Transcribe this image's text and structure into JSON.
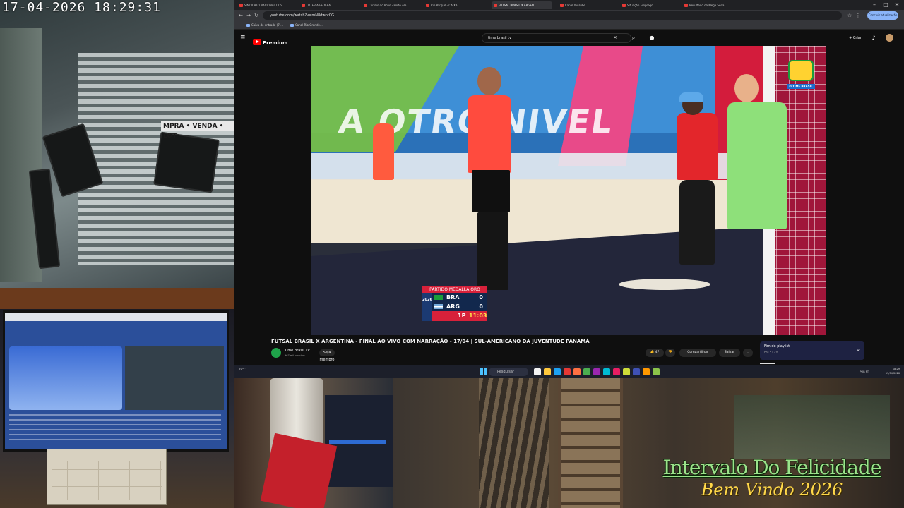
{
  "camera": {
    "timestamp": "17-04-2026  18:29:31",
    "sign_text": "MPRA • VENDA • LOT"
  },
  "overlay": {
    "line1": "Intervalo Do Felicidade",
    "line2": "Bem Vindo 2026"
  },
  "browser": {
    "tabs": [
      {
        "label": "SINDICATO NACIONAL DOS..."
      },
      {
        "label": "LOTERIA FEDERAL"
      },
      {
        "label": "Correio do Povo - Porto Ale..."
      },
      {
        "label": "Rio Parquê - CAIXA..."
      },
      {
        "label": "FUTSAL BRASIL X ARGENT..."
      },
      {
        "label": "Canal YouTube"
      },
      {
        "label": "Situação Emprego..."
      },
      {
        "label": "Resultado da Mega Sena..."
      }
    ],
    "url": "youtube.com/watch?v=mN8dwcc0G",
    "gemini_label": "Concluir atualização",
    "bookmarks": [
      "Caixa de entrada (7)...",
      "Canal Rio Grande..."
    ]
  },
  "youtube": {
    "logo": "Premium",
    "search_value": "time brasil tv",
    "create_label": "+ Criar",
    "video_title": "FUTSAL BRASIL X ARGENTINA - FINAL AO VIVO COM NARRAÇÃO - 17/04 | SUL-AMERICANO DA JUVENTUDE PANAMÁ",
    "channel_name": "Time Brasil TV",
    "channel_subs": "967 mil inscritos",
    "member_label": "Seja membro",
    "likes": "47",
    "share_label": "Compartilhar",
    "save_label": "Salvar",
    "more_label": "…",
    "playlist": {
      "title": "Fim de playlist",
      "meta": "PRE • 4 / 9"
    },
    "banner_text": "A OTRO NIVEL"
  },
  "scorebug": {
    "title": "PARTIDO MEDALLA ORO",
    "logo": "2026",
    "team1": {
      "name": "BRA",
      "score": "0"
    },
    "team2": {
      "name": "ARG",
      "score": "0"
    },
    "period": "1P",
    "clock": "11:03"
  },
  "channel_bug": {
    "text": "O TIME BRASIL"
  },
  "taskbar": {
    "weather": "19°C",
    "search_label": "Pesquisar",
    "lang": "POR PT",
    "time": "18:29",
    "date": "17/04/2026"
  },
  "colors": {
    "youtube_red": "#ff0000",
    "overlay_green": "#9be28a",
    "overlay_yellow": "#ffd84a",
    "score_red": "#d8213a",
    "score_navy": "#12284d"
  }
}
